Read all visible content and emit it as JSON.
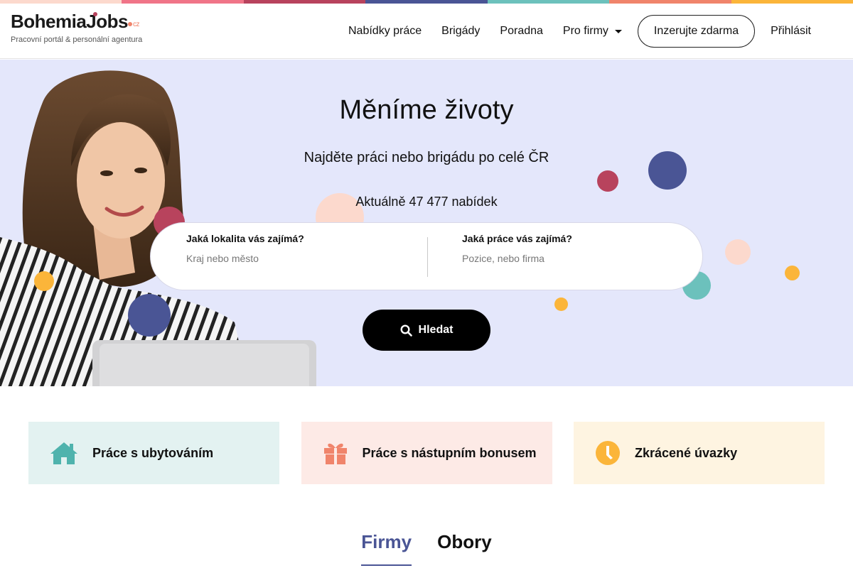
{
  "colors": {
    "stripe": [
      "#fcd9cd",
      "#f07488",
      "#b8435d",
      "#4a5595",
      "#6cc1bc",
      "#f0846b",
      "#fbb53a"
    ],
    "hero_bg": "#e4e7fb",
    "accent_navy": "#4a5595",
    "accent_teal": "#6cc1bc",
    "accent_coral": "#f0846b",
    "accent_yellow": "#fbb53a"
  },
  "logo": {
    "name": "BohemiaJobs",
    "suffix": "cz",
    "tagline": "Pracovní portál & personální agentura"
  },
  "nav": {
    "items": [
      "Nabídky práce",
      "Brigády",
      "Poradna"
    ],
    "companies": "Pro firmy",
    "cta": "Inzerujte zdarma",
    "login": "Přihlásit"
  },
  "hero": {
    "title": "Měníme životy",
    "subtitle": "Najděte práci nebo brigádu po celé ČR",
    "count": "Aktuálně 47 477 nabídek"
  },
  "search": {
    "location_label": "Jaká lokalita vás zajímá?",
    "location_placeholder": "Kraj nebo město",
    "job_label": "Jaká práce vás zajímá?",
    "job_placeholder": "Pozice, nebo firma",
    "button": "Hledat"
  },
  "categories": [
    {
      "label": "Práce s ubytováním",
      "icon": "house-icon",
      "bg": "#e3f2f1"
    },
    {
      "label": "Práce s nástupním bonusem",
      "icon": "gift-icon",
      "bg": "#fdeae6"
    },
    {
      "label": "Zkrácené úvazky",
      "icon": "clock-icon",
      "bg": "#fef4e1"
    }
  ],
  "tabs": [
    "Firmy",
    "Obory"
  ]
}
